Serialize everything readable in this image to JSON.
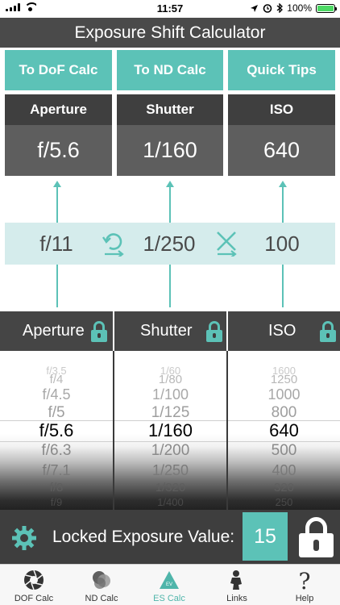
{
  "status_bar": {
    "time": "11:57",
    "battery": "100%"
  },
  "title": "Exposure Shift Calculator",
  "nav_buttons": [
    {
      "label": "To DoF Calc"
    },
    {
      "label": "To ND Calc"
    },
    {
      "label": "Quick Tips"
    }
  ],
  "result": {
    "aperture": {
      "label": "Aperture",
      "value": "f/5.6"
    },
    "shutter": {
      "label": "Shutter",
      "value": "1/160"
    },
    "iso": {
      "label": "ISO",
      "value": "640"
    }
  },
  "reference": {
    "aperture": "f/11",
    "shutter": "1/250",
    "iso": "100"
  },
  "picker_headers": {
    "aperture": "Aperture",
    "shutter": "Shutter",
    "iso": "ISO"
  },
  "pickers": {
    "aperture": [
      "f/3.5",
      "f/4",
      "f/4.5",
      "f/5",
      "f/5.6",
      "f/6.3",
      "f/7.1",
      "f/8",
      "f/9"
    ],
    "shutter": [
      "1/60",
      "1/80",
      "1/100",
      "1/125",
      "1/160",
      "1/200",
      "1/250",
      "1/320",
      "1/400"
    ],
    "iso": [
      "1600",
      "1250",
      "1000",
      "800",
      "640",
      "500",
      "400",
      "320",
      "250"
    ]
  },
  "locked_ev": {
    "label": "Locked Exposure Value:",
    "value": "15"
  },
  "tabs": [
    {
      "label": "DOF Calc",
      "icon": "aperture-icon"
    },
    {
      "label": "ND Calc",
      "icon": "nd-filter-icon"
    },
    {
      "label": "ES Calc",
      "icon": "es-calc-icon",
      "active": true
    },
    {
      "label": "Links",
      "icon": "links-icon"
    },
    {
      "label": "Help",
      "icon": "help-icon"
    }
  ],
  "colors": {
    "accent": "#5cc2b7",
    "dark": "#3f3f3f",
    "mid": "#5e5e5e",
    "pale": "#d5ecec"
  }
}
